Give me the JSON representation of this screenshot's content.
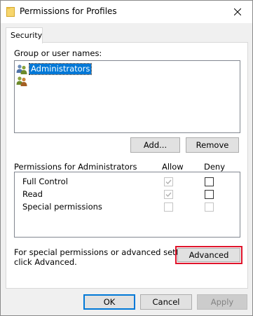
{
  "window": {
    "title": "Permissions for Profiles"
  },
  "tabs": [
    {
      "label": "Security",
      "selected": true
    }
  ],
  "group_section": {
    "label": "Group or user names:",
    "items": [
      {
        "name": "Administrators",
        "selected": true,
        "icon": "users-group-icon"
      },
      {
        "name": "",
        "selected": false,
        "icon": "users-group-icon"
      }
    ]
  },
  "buttons": {
    "add": "Add...",
    "remove": "Remove",
    "advanced": "Advanced",
    "ok": "OK",
    "cancel": "Cancel",
    "apply": "Apply"
  },
  "permissions_section": {
    "header": "Permissions for Administrators",
    "allow_header": "Allow",
    "deny_header": "Deny",
    "rows": [
      {
        "name": "Full Control",
        "allow": {
          "checked": true,
          "disabled": true
        },
        "deny": {
          "checked": false,
          "disabled": false
        }
      },
      {
        "name": "Read",
        "allow": {
          "checked": true,
          "disabled": true
        },
        "deny": {
          "checked": false,
          "disabled": false
        }
      },
      {
        "name": "Special permissions",
        "allow": {
          "checked": false,
          "disabled": true
        },
        "deny": {
          "checked": false,
          "disabled": true
        }
      }
    ]
  },
  "advanced_note": {
    "line1": "For special permissions or advanced settings,",
    "line2": "click Advanced."
  },
  "colors": {
    "selection": "#0078d7",
    "highlight_border": "#e0142b",
    "ok_border": "#0078d7"
  }
}
